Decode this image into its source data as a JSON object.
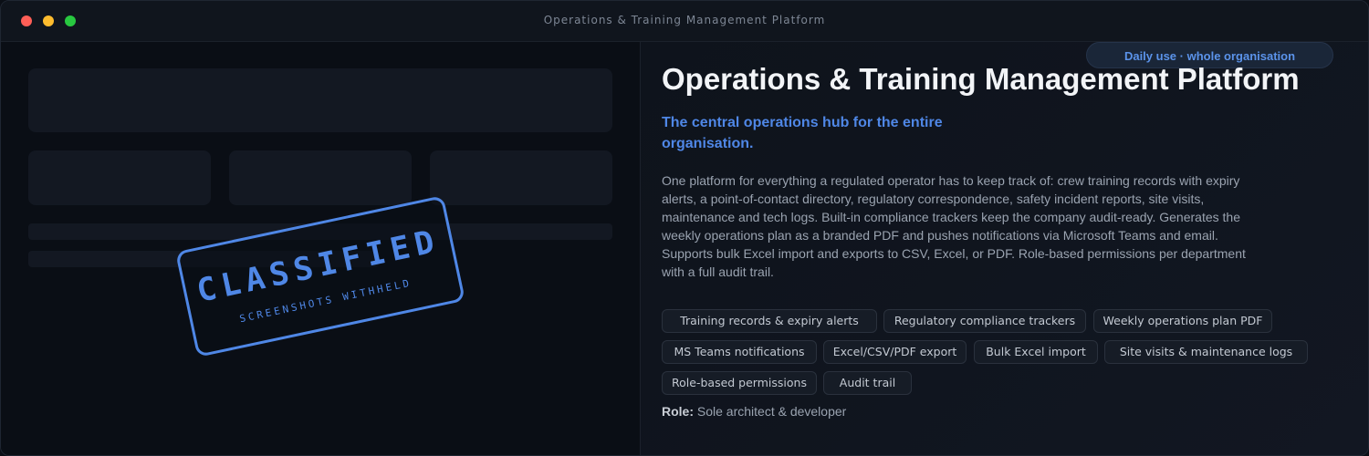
{
  "window": {
    "title": "Operations & Training Management Platform",
    "controls": [
      "close",
      "minimize",
      "maximize"
    ]
  },
  "preview": {
    "stamp_text": "CLASSIFIED",
    "stamp_subtext": "SCREENSHOTS WITHHELD"
  },
  "badge": "Daily use · whole organisation",
  "title": "Operations & Training Management Platform",
  "subtitle": "The central operations hub for the entire organisation.",
  "description": "One platform for everything a regulated operator has to keep track of: crew training records with expiry alerts, a point-of-contact directory, regulatory correspondence, safety incident reports, site visits, maintenance and tech logs. Built-in compliance trackers keep the company audit-ready. Generates the weekly operations plan as a branded PDF and pushes notifications via Microsoft Teams and email. Supports bulk Excel import and exports to CSV, Excel, or PDF. Role-based permissions per department with a full audit trail.",
  "tags": [
    "Training records & expiry alerts",
    "Regulatory compliance trackers",
    "Weekly operations plan PDF",
    "MS Teams notifications",
    "Excel/CSV/PDF export",
    "Bulk Excel import",
    "Site visits & maintenance logs",
    "Role-based permissions",
    "Audit trail"
  ],
  "role": {
    "label": "Role:",
    "value": "Sole architect & developer"
  },
  "colors": {
    "accent": "#4f87e6",
    "close": "#ff5f57",
    "minimize": "#febc2e",
    "maximize": "#28c840"
  }
}
